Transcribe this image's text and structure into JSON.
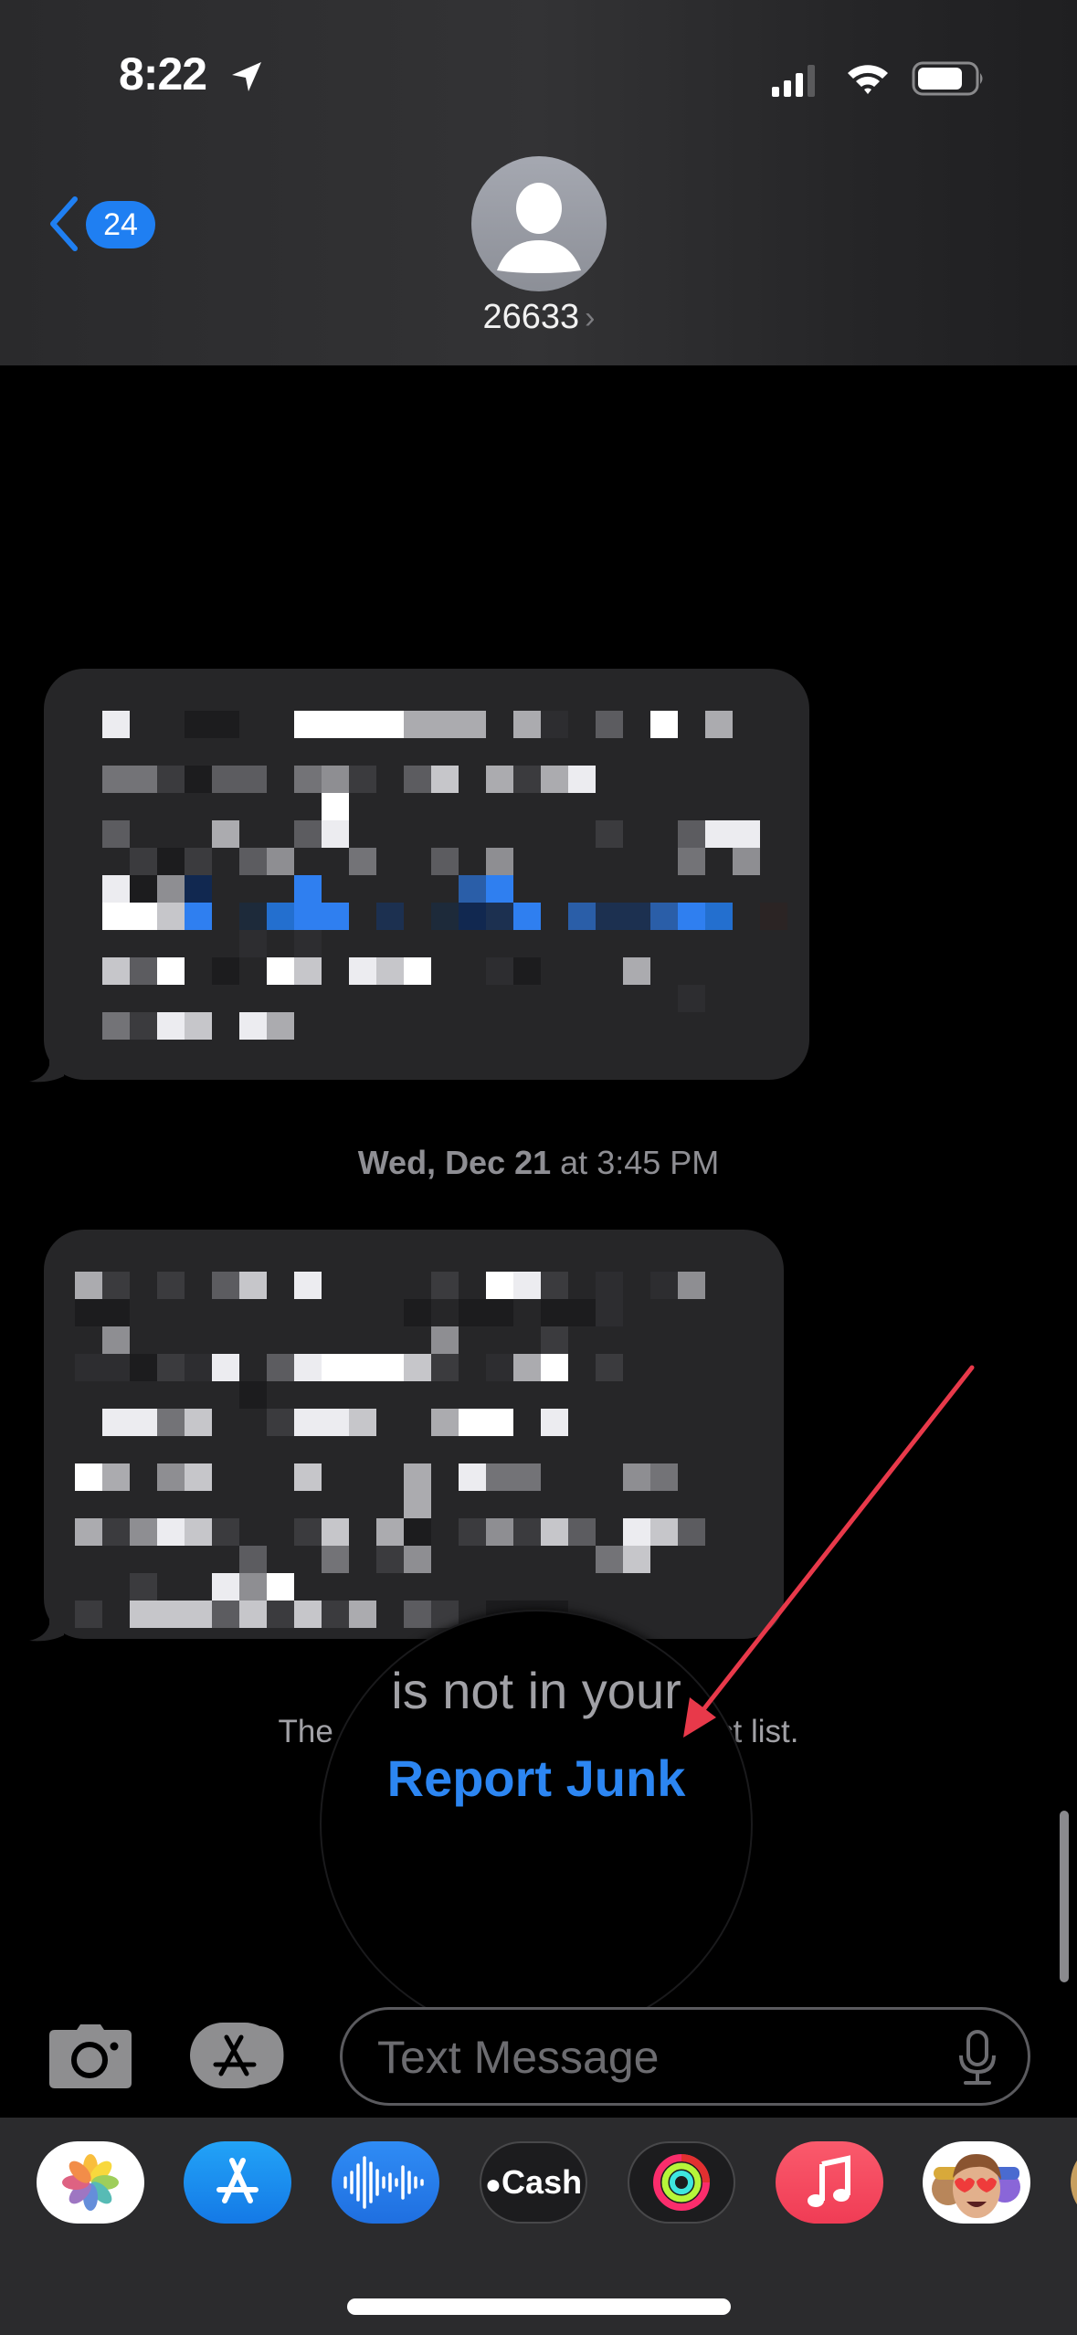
{
  "status_bar": {
    "time": "8:22",
    "location_icon": "location-arrow-icon",
    "signal_bars_active": 3,
    "signal_bars_total": 4,
    "wifi_icon": "wifi-icon",
    "battery_level": 0.8
  },
  "header": {
    "back_icon": "chevron-left-icon",
    "unread_count": "24",
    "contact_avatar_icon": "person-placeholder-icon",
    "contact_name": "26633",
    "contact_chevron": "›"
  },
  "conversation": {
    "messages": [
      {
        "direction": "incoming",
        "redacted": true,
        "mosaic_palette": {
          ".": "#262628",
          "a": "#2d2d30",
          "b": "#3b3b3e",
          "c": "#5c5c60",
          "d": "#737377",
          "e": "#8e8e92",
          "f": "#ababaf",
          "g": "#c6c6ca",
          "h": "#ececf0",
          "i": "#ffffff",
          "k": "#1c1c1e",
          "B": "#2f7ff0",
          "C": "#236fcf",
          "D": "#2a5ea8",
          "E": "#112850",
          "F": "#1c3050",
          "G": "#1d2a3a",
          "H": "#2b2424"
        },
        "mosaic_rows": [
          ".h..kk..iiiifff.fa.c.i.f.",
          ".........................",
          ".ddbkcc.deb.cg.fbfh......",
          ".........i...............",
          ".c...f..ch.........b..chh.",
          "..bkb.ce..d..c.e......d.e",
          ".hkeE...B.....DB.........",
          ".iigB.GCBB.F.GEFB.DFFDBC.H",
          "......a.a................",
          ".gci.k.ig.hgi..ak...f....",
          "......................a..",
          ".dbhg.hf.................",
          "........................."
        ]
      },
      {
        "timestamp_day": "Wed, Dec 21",
        "timestamp_connector": " at ",
        "timestamp_time": "3:45 PM"
      },
      {
        "direction": "incoming",
        "redacted": true,
        "mosaic_palette": {
          ".": "#262628",
          "a": "#2d2d30",
          "b": "#3b3b3e",
          "c": "#5c5c60",
          "d": "#737377",
          "e": "#8e8e92",
          "f": "#ababaf",
          "g": "#c6c6ca",
          "h": "#ececf0",
          "i": "#ffffff",
          "k": "#1c1c1e"
        },
        "mosaic_rows": [
          "fb.b.cg.h....b.ihb.a.ae..",
          "kk..........k.kk.kka.....",
          ".e...........e...b.......",
          "aakbah.chiiigb.afi.b.....",
          "......k..................",
          ".hhdg..bhhg..fii.h.......",
          ".........................",
          "if.eg...g...f.hdd...ed...",
          "............f............",
          "fbehgb..bg.fk.bebgc.hgc..",
          "......c..d.be......dg....",
          "..b..hei.................",
          "b.gggcgbgbf.cb.kkk......."
        ]
      }
    ],
    "notice_prefix": "The sender is not in your contact list.",
    "magnified_text": "is not in your",
    "report_junk_label": "Report Junk"
  },
  "annotation": {
    "type": "arrow",
    "color": "#e8394a",
    "points_to": "report-junk-link"
  },
  "compose": {
    "camera_icon": "camera-icon",
    "apps_icon": "app-store-icon",
    "placeholder": "Text Message",
    "value": "",
    "mic_icon": "microphone-icon"
  },
  "app_drawer": {
    "apps": [
      {
        "name": "Photos",
        "icon": "photos-icon"
      },
      {
        "name": "App Store",
        "icon": "app-store-icon"
      },
      {
        "name": "Audio Message",
        "icon": "audio-waveform-icon"
      },
      {
        "name": "Apple Cash",
        "icon": "apple-cash-icon",
        "label": "Cash"
      },
      {
        "name": "Activity",
        "icon": "activity-rings-icon"
      },
      {
        "name": "Music",
        "icon": "music-note-icon"
      },
      {
        "name": "Memoji Stickers",
        "icon": "memoji-icon"
      },
      {
        "name": "More",
        "icon": "partial-app-icon"
      }
    ]
  },
  "scroll": {
    "position_fraction": 0.95
  }
}
